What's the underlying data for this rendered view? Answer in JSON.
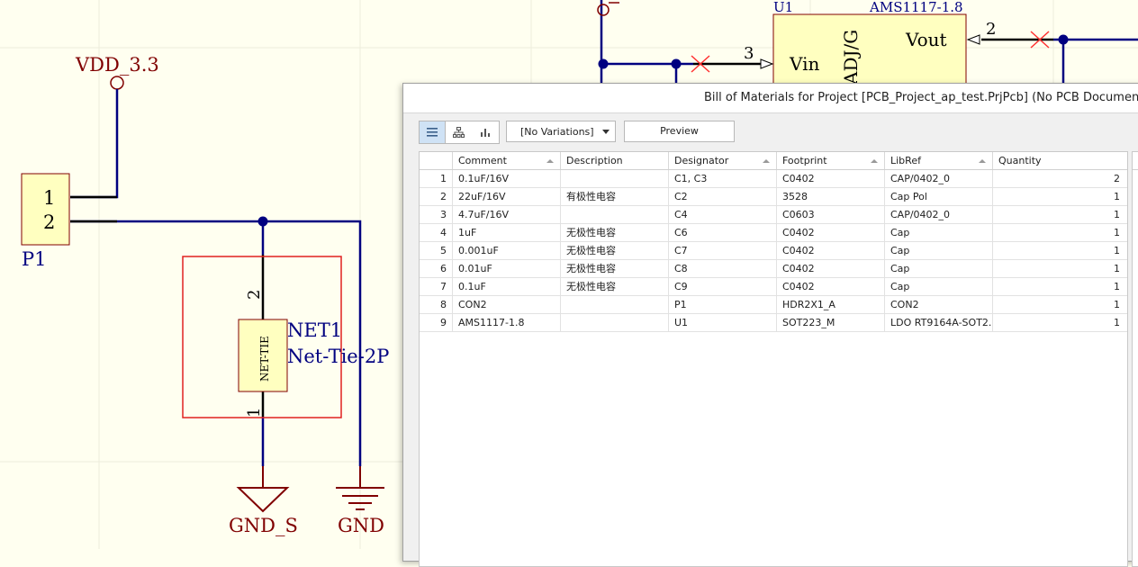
{
  "schematic": {
    "power_port": "VDD_3.3",
    "connector": {
      "designator": "P1",
      "pins": [
        "1",
        "2"
      ]
    },
    "net_tie": {
      "designator": "NET1",
      "comment": "Net-Tie-2P",
      "body_label": "NET-TIE",
      "pins": [
        "2",
        "1"
      ]
    },
    "grounds": [
      "GND_S",
      "GND"
    ],
    "regulator": {
      "designator": "U1",
      "comment": "AMS1117-1.8",
      "pin_vin": "Vin",
      "pin_vout": "Vout",
      "pin_adj": "ADJ/G",
      "pin3": "3",
      "pin2": "2"
    },
    "colors": {
      "wire": "#000080",
      "net_label": "#800000",
      "component_fill": "#ffffc0",
      "component_border": "#800000",
      "junction": "#000080",
      "room_border": "#e02020"
    }
  },
  "dialog": {
    "title": "Bill of Materials for Project [PCB_Project_ap_test.PrjPcb] (No PCB Document Selected)",
    "view_modes": [
      "list-view-icon",
      "tree-view-icon",
      "chart-view-icon"
    ],
    "variations": "[No Variations]",
    "preview_label": "Preview",
    "columns": [
      "Comment",
      "Description",
      "Designator",
      "Footprint",
      "LibRef",
      "Quantity"
    ],
    "rows": [
      {
        "n": "1",
        "comment": "0.1uF/16V",
        "description": "",
        "designator": "C1, C3",
        "footprint": "C0402",
        "libref": "CAP/0402_0",
        "quantity": "2"
      },
      {
        "n": "2",
        "comment": "22uF/16V",
        "description": "有极性电容",
        "designator": "C2",
        "footprint": "3528",
        "libref": "Cap Pol",
        "quantity": "1"
      },
      {
        "n": "3",
        "comment": "4.7uF/16V",
        "description": "",
        "designator": "C4",
        "footprint": "C0603",
        "libref": "CAP/0402_0",
        "quantity": "1"
      },
      {
        "n": "4",
        "comment": "1uF",
        "description": "无极性电容",
        "designator": "C6",
        "footprint": "C0402",
        "libref": "Cap",
        "quantity": "1"
      },
      {
        "n": "5",
        "comment": "0.001uF",
        "description": "无极性电容",
        "designator": "C7",
        "footprint": "C0402",
        "libref": "Cap",
        "quantity": "1"
      },
      {
        "n": "6",
        "comment": "0.01uF",
        "description": "无极性电容",
        "designator": "C8",
        "footprint": "C0402",
        "libref": "Cap",
        "quantity": "1"
      },
      {
        "n": "7",
        "comment": "0.1uF",
        "description": "无极性电容",
        "designator": "C9",
        "footprint": "C0402",
        "libref": "Cap",
        "quantity": "1"
      },
      {
        "n": "8",
        "comment": "CON2",
        "description": "",
        "designator": "P1",
        "footprint": "HDR2X1_A",
        "libref": "CON2",
        "quantity": "1"
      },
      {
        "n": "9",
        "comment": "AMS1117-1.8",
        "description": "",
        "designator": "U1",
        "footprint": "SOT223_M",
        "libref": "LDO RT9164A-SOT2...",
        "quantity": "1"
      }
    ]
  }
}
